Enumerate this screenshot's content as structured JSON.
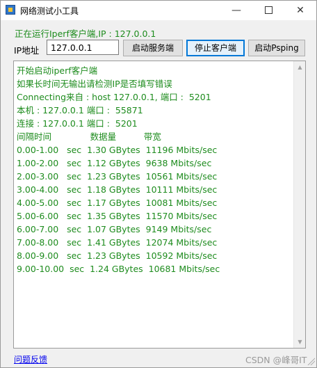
{
  "window": {
    "title": "网络测试小工具",
    "controls": {
      "minimize": "—",
      "close": "✕"
    }
  },
  "status": {
    "text": "正在运行Iperf客户端,IP : 127.0.0.1"
  },
  "ip": {
    "label": "IP地址",
    "value": "127.0.0.1"
  },
  "buttons": {
    "start_server": "启动服务端",
    "stop_client": "停止客户端",
    "start_psping": "启动Psping"
  },
  "log": {
    "lines": [
      "开始启动iperf客户端",
      "如果长时间无输出请检测IP是否填写错误",
      "Connecting来自 : host 127.0.0.1, 端口 :  5201",
      "本机 : 127.0.0.1 端口 :  55871",
      "连接 : 127.0.0.1 端口 :  5201",
      "间隔时间              数据量          带宽",
      "0.00-1.00   sec  1.30 GBytes  11196 Mbits/sec",
      "1.00-2.00   sec  1.12 GBytes  9638 Mbits/sec",
      "2.00-3.00   sec  1.23 GBytes  10561 Mbits/sec",
      "3.00-4.00   sec  1.18 GBytes  10111 Mbits/sec",
      "4.00-5.00   sec  1.17 GBytes  10081 Mbits/sec",
      "5.00-6.00   sec  1.35 GBytes  11570 Mbits/sec",
      "6.00-7.00   sec  1.07 GBytes  9149 Mbits/sec",
      "7.00-8.00   sec  1.41 GBytes  12074 Mbits/sec",
      "8.00-9.00   sec  1.23 GBytes  10592 Mbits/sec",
      "9.00-10.00  sec  1.24 GBytes  10681 Mbits/sec"
    ]
  },
  "footer": {
    "feedback_link": "问题反馈",
    "watermark": "CSDN @峰哥IT"
  },
  "colors": {
    "log_text": "#1e8c1e",
    "link": "#0000ee",
    "focus_border": "#0078d7"
  },
  "icons": {
    "app": "app-icon",
    "minimize": "minimize-icon",
    "maximize": "maximize-icon",
    "close": "close-icon",
    "scroll_up": "scroll-up-arrow-icon",
    "scroll_down": "scroll-down-arrow-icon"
  }
}
